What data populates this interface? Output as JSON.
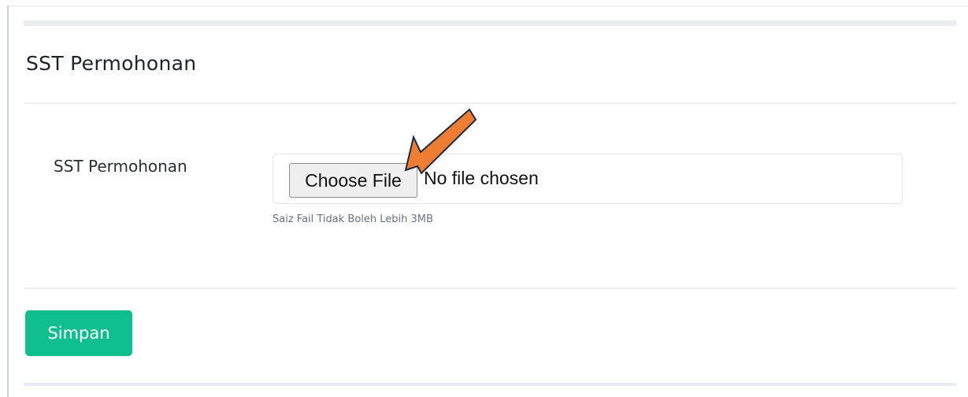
{
  "card": {
    "title": "SST Permohonan"
  },
  "form": {
    "field_label": "SST Permohonan",
    "file_button_label": "Choose File",
    "file_status": "No file chosen",
    "hint": "Saiz Fail Tidak Boleh Lebih 3MB"
  },
  "actions": {
    "save_label": "Simpan"
  },
  "annotation": {
    "icon": "arrow-pointer-icon",
    "color": "#ed7d31"
  },
  "colors": {
    "save_button": "#0fbf8e",
    "divider": "#eceef1"
  }
}
